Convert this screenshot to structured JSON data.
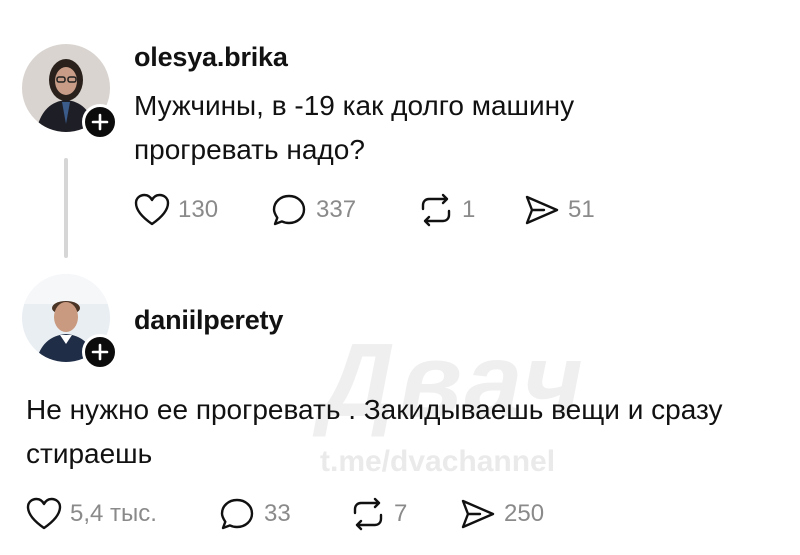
{
  "posts": [
    {
      "username": "olesya.brika",
      "text": "Мужчины, в -19 как долго машину прогревать надо?",
      "likes": "130",
      "replies": "337",
      "reposts": "1",
      "shares": "51"
    },
    {
      "username": "daniilperety",
      "text": "Не нужно ее прогревать . Закидываешь вещи и сразу стираешь",
      "likes": "5,4 тыс.",
      "replies": "33",
      "reposts": "7",
      "shares": "250"
    }
  ],
  "watermark": {
    "brand": "Двач",
    "link": "t.me/dvachannel"
  },
  "icons": [
    "plus-icon",
    "heart-icon",
    "comment-icon",
    "repost-icon",
    "share-icon"
  ],
  "colors": {
    "text": "#111111",
    "muted": "#8a8a8a",
    "badge": "#0c0c0c",
    "thread_line": "#d6d6d6"
  }
}
